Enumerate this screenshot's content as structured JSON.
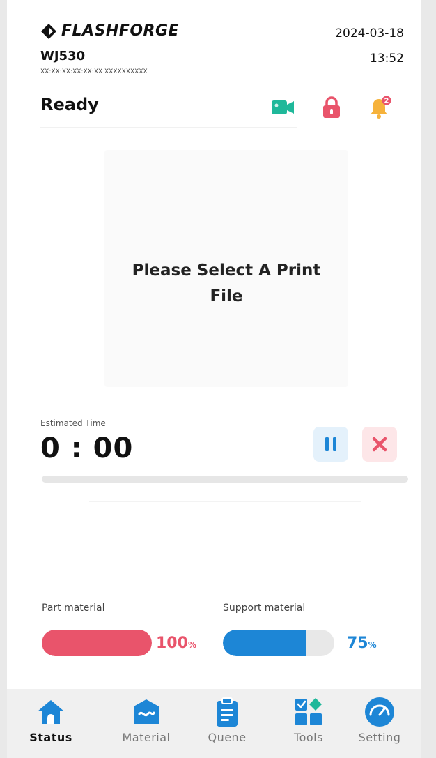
{
  "header": {
    "brand": "FLASHFORGE",
    "device_name": "WJ530",
    "device_id": "XX:XX:XX:XX:XX:XX   XXXXXXXXXX",
    "date": "2024-03-18",
    "time": "13:52"
  },
  "status": {
    "text": "Ready",
    "icons": [
      "camera-icon",
      "lock-icon",
      "notification-bell-icon"
    ],
    "notification_count": "2"
  },
  "preview": {
    "message_line1": "Please Select A Print",
    "message_line2": "File"
  },
  "job": {
    "estimated_label": "Estimated Time",
    "estimated_value": "0 : 00",
    "controls": [
      "pause-icon",
      "stop-icon"
    ]
  },
  "materials": {
    "part": {
      "label": "Part material",
      "percent": "100",
      "unit": "%",
      "level": 1.0,
      "color": "#e9546b"
    },
    "support": {
      "label": "Support material",
      "percent": "75",
      "unit": "%",
      "level": 0.75,
      "color": "#1d86d6"
    }
  },
  "nav": {
    "items": [
      {
        "label": "Status",
        "icon": "home-icon",
        "active": true
      },
      {
        "label": "Material",
        "icon": "material-icon",
        "active": false
      },
      {
        "label": "Quene",
        "icon": "queue-clipboard-icon",
        "active": false
      },
      {
        "label": "Tools",
        "icon": "tools-grid-icon",
        "active": false
      },
      {
        "label": "Setting",
        "icon": "settings-gauge-icon",
        "active": false
      }
    ]
  },
  "colors": {
    "accent_blue": "#1d86d6",
    "accent_red": "#e9546b",
    "camera_green": "#1fb89a",
    "bell_orange": "#f6b23b"
  }
}
